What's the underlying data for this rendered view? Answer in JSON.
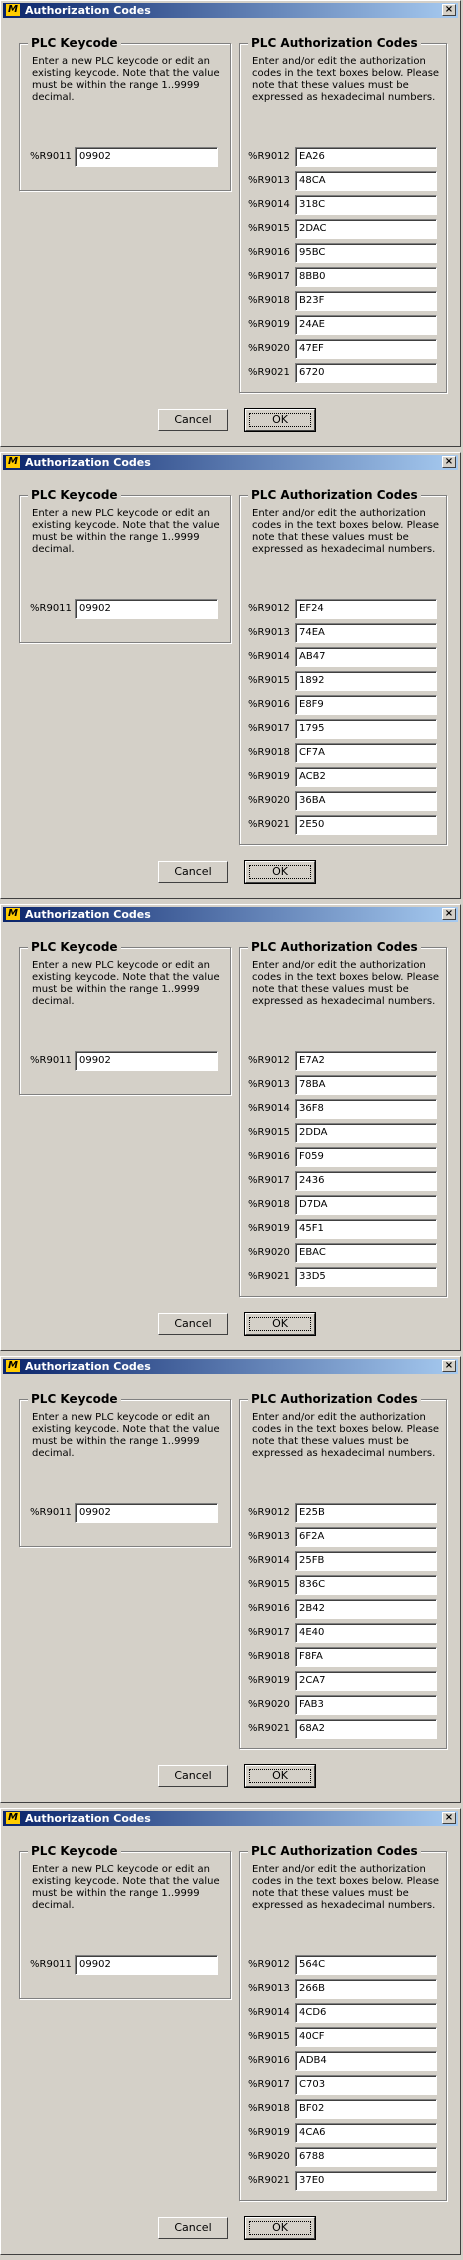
{
  "dialogs": [
    {
      "title": "Authorization Codes",
      "keycode": {
        "heading": "PLC Keycode",
        "description": [
          "Enter a new PLC keycode or edit an",
          "existing keycode.  Note that the value",
          "must be within the range 1..9999",
          "decimal."
        ],
        "label": "%R9011",
        "value": "09902"
      },
      "auth": {
        "heading": "PLC Authorization Codes",
        "description": [
          "Enter and/or edit the authorization",
          "codes in the text boxes below.  Please",
          "note that these values must be",
          "expressed as hexadecimal numbers."
        ],
        "rows": [
          {
            "label": "%R9012",
            "value": "EA26"
          },
          {
            "label": "%R9013",
            "value": "48CA"
          },
          {
            "label": "%R9014",
            "value": "318C"
          },
          {
            "label": "%R9015",
            "value": "2DAC"
          },
          {
            "label": "%R9016",
            "value": "95BC"
          },
          {
            "label": "%R9017",
            "value": "8BB0"
          },
          {
            "label": "%R9018",
            "value": "B23F"
          },
          {
            "label": "%R9019",
            "value": "24AE"
          },
          {
            "label": "%R9020",
            "value": "47EF"
          },
          {
            "label": "%R9021",
            "value": "6720"
          }
        ]
      },
      "cancel_label": "Cancel",
      "ok_label": "OK"
    },
    {
      "title": "Authorization Codes",
      "keycode": {
        "heading": "PLC Keycode",
        "description": [
          "Enter a new PLC keycode or edit an",
          "existing keycode.  Note that the value",
          "must be within the range 1..9999",
          "decimal."
        ],
        "label": "%R9011",
        "value": "09902"
      },
      "auth": {
        "heading": "PLC Authorization Codes",
        "description": [
          "Enter and/or edit the authorization",
          "codes in the text boxes below.  Please",
          "note that these values must be",
          "expressed as hexadecimal numbers."
        ],
        "rows": [
          {
            "label": "%R9012",
            "value": "EF24"
          },
          {
            "label": "%R9013",
            "value": "74EA"
          },
          {
            "label": "%R9014",
            "value": "AB47"
          },
          {
            "label": "%R9015",
            "value": "1892"
          },
          {
            "label": "%R9016",
            "value": "E8F9"
          },
          {
            "label": "%R9017",
            "value": "1795"
          },
          {
            "label": "%R9018",
            "value": "CF7A"
          },
          {
            "label": "%R9019",
            "value": "ACB2"
          },
          {
            "label": "%R9020",
            "value": "36BA"
          },
          {
            "label": "%R9021",
            "value": "2E50"
          }
        ]
      },
      "cancel_label": "Cancel",
      "ok_label": "OK"
    },
    {
      "title": "Authorization Codes",
      "keycode": {
        "heading": "PLC Keycode",
        "description": [
          "Enter a new PLC keycode or edit an",
          "existing keycode.  Note that the value",
          "must be within the range 1..9999",
          "decimal."
        ],
        "label": "%R9011",
        "value": "09902"
      },
      "auth": {
        "heading": "PLC Authorization Codes",
        "description": [
          "Enter and/or edit the authorization",
          "codes in the text boxes below.  Please",
          "note that these values must be",
          "expressed as hexadecimal numbers."
        ],
        "rows": [
          {
            "label": "%R9012",
            "value": "E7A2"
          },
          {
            "label": "%R9013",
            "value": "78BA"
          },
          {
            "label": "%R9014",
            "value": "36F8"
          },
          {
            "label": "%R9015",
            "value": "2DDA"
          },
          {
            "label": "%R9016",
            "value": "F059"
          },
          {
            "label": "%R9017",
            "value": "2436"
          },
          {
            "label": "%R9018",
            "value": "D7DA"
          },
          {
            "label": "%R9019",
            "value": "45F1"
          },
          {
            "label": "%R9020",
            "value": "EBAC"
          },
          {
            "label": "%R9021",
            "value": "33D5"
          }
        ]
      },
      "cancel_label": "Cancel",
      "ok_label": "OK"
    },
    {
      "title": "Authorization Codes",
      "keycode": {
        "heading": "PLC Keycode",
        "description": [
          "Enter a new PLC keycode or edit an",
          "existing keycode.  Note that the value",
          "must be within the range 1..9999",
          "decimal."
        ],
        "label": "%R9011",
        "value": "09902"
      },
      "auth": {
        "heading": "PLC Authorization Codes",
        "description": [
          "Enter and/or edit the authorization",
          "codes in the text boxes below.  Please",
          "note that these values must be",
          "expressed as hexadecimal numbers."
        ],
        "rows": [
          {
            "label": "%R9012",
            "value": "E25B"
          },
          {
            "label": "%R9013",
            "value": "6F2A"
          },
          {
            "label": "%R9014",
            "value": "25FB"
          },
          {
            "label": "%R9015",
            "value": "836C"
          },
          {
            "label": "%R9016",
            "value": "2B42"
          },
          {
            "label": "%R9017",
            "value": "4E40"
          },
          {
            "label": "%R9018",
            "value": "F8FA"
          },
          {
            "label": "%R9019",
            "value": "2CA7"
          },
          {
            "label": "%R9020",
            "value": "FAB3"
          },
          {
            "label": "%R9021",
            "value": "68A2"
          }
        ]
      },
      "cancel_label": "Cancel",
      "ok_label": "OK"
    },
    {
      "title": "Authorization Codes",
      "keycode": {
        "heading": "PLC Keycode",
        "description": [
          "Enter a new PLC keycode or edit an",
          "existing keycode.  Note that the value",
          "must be within the range 1..9999",
          "decimal."
        ],
        "label": "%R9011",
        "value": "09902"
      },
      "auth": {
        "heading": "PLC Authorization Codes",
        "description": [
          "Enter and/or edit the authorization",
          "codes in the text boxes below.  Please",
          "note that these values must be",
          "expressed as hexadecimal numbers."
        ],
        "rows": [
          {
            "label": "%R9012",
            "value": "564C"
          },
          {
            "label": "%R9013",
            "value": "266B"
          },
          {
            "label": "%R9014",
            "value": "4CD6"
          },
          {
            "label": "%R9015",
            "value": "40CF"
          },
          {
            "label": "%R9016",
            "value": "ADB4"
          },
          {
            "label": "%R9017",
            "value": "C703"
          },
          {
            "label": "%R9018",
            "value": "BF02"
          },
          {
            "label": "%R9019",
            "value": "4CA6"
          },
          {
            "label": "%R9020",
            "value": "6788"
          },
          {
            "label": "%R9021",
            "value": "37E0"
          }
        ]
      },
      "cancel_label": "Cancel",
      "ok_label": "OK"
    }
  ]
}
